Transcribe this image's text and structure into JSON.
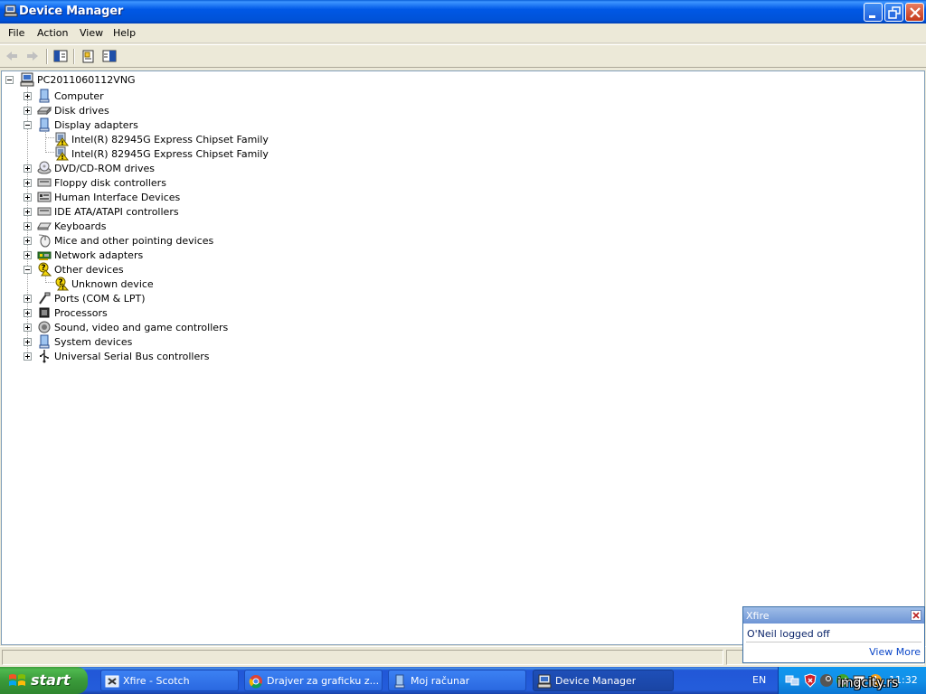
{
  "window": {
    "title": "Device Manager"
  },
  "menu": {
    "file": "File",
    "action": "Action",
    "view": "View",
    "help": "Help"
  },
  "toolbar": {
    "buttons": [
      "back-icon",
      "forward-icon",
      "show-hide-tree-icon",
      "properties-icon",
      "help-icon"
    ]
  },
  "tree": {
    "root": "PC2011060112VNG",
    "categories": [
      {
        "label": "Computer",
        "icon": "computer-icon",
        "expanded": false
      },
      {
        "label": "Disk drives",
        "icon": "disk-drive-icon",
        "expanded": false
      },
      {
        "label": "Display adapters",
        "icon": "display-adapter-icon",
        "expanded": true
      },
      {
        "label": "Intel(R) 82945G Express Chipset Family",
        "icon": "warning-device-icon",
        "child": true
      },
      {
        "label": "Intel(R) 82945G Express Chipset Family",
        "icon": "warning-device-icon",
        "child": true
      },
      {
        "label": "DVD/CD-ROM drives",
        "icon": "cdrom-icon",
        "expanded": false
      },
      {
        "label": "Floppy disk controllers",
        "icon": "floppy-controller-icon",
        "expanded": false
      },
      {
        "label": "Human Interface Devices",
        "icon": "hid-icon",
        "expanded": false
      },
      {
        "label": "IDE ATA/ATAPI controllers",
        "icon": "ide-controller-icon",
        "expanded": false
      },
      {
        "label": "Keyboards",
        "icon": "keyboard-icon",
        "expanded": false
      },
      {
        "label": "Mice and other pointing devices",
        "icon": "mouse-icon",
        "expanded": false
      },
      {
        "label": "Network adapters",
        "icon": "network-adapter-icon",
        "expanded": false
      },
      {
        "label": "Other devices",
        "icon": "other-devices-icon",
        "expanded": true
      },
      {
        "label": "Unknown device",
        "icon": "unknown-device-icon",
        "child": true
      },
      {
        "label": "Ports (COM & LPT)",
        "icon": "port-icon",
        "expanded": false
      },
      {
        "label": "Processors",
        "icon": "processor-icon",
        "expanded": false
      },
      {
        "label": "Sound, video and game controllers",
        "icon": "sound-icon",
        "expanded": false
      },
      {
        "label": "System devices",
        "icon": "system-device-icon",
        "expanded": false
      },
      {
        "label": "Universal Serial Bus controllers",
        "icon": "usb-icon",
        "expanded": false
      }
    ]
  },
  "xfire": {
    "title": "Xfire",
    "message": "O'Neil logged off",
    "link": "View More"
  },
  "taskbar": {
    "start": "start",
    "tasks": [
      {
        "label": "Xfire - Scotch",
        "icon": "xfire-icon"
      },
      {
        "label": "Drajver za graficku z...",
        "icon": "chrome-icon"
      },
      {
        "label": "Moj računar",
        "icon": "my-computer-icon"
      },
      {
        "label": "Device Manager",
        "icon": "device-manager-icon"
      }
    ],
    "language": "EN",
    "clock": "11:32",
    "watermark": "imgcity.rs"
  },
  "colors": {
    "titlebar": "#0058e6",
    "taskbar": "#245ddb",
    "start": "#3a9a3a",
    "tray": "#1290e8",
    "warning": "#f5d70a"
  }
}
